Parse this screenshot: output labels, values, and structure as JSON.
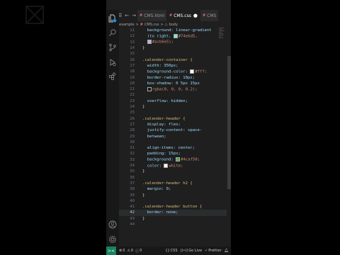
{
  "window": {
    "menu_icon": "menu-icon",
    "tabs": [
      {
        "icon": "css-file-icon",
        "label": "CMS.html",
        "close": "×",
        "active": false
      },
      {
        "icon": "css-file-icon",
        "label": "CMS.css",
        "close": "●",
        "active": true
      },
      {
        "icon": "css-file-icon",
        "label": "CMS",
        "close": "",
        "active": false
      }
    ]
  },
  "breadcrumb": {
    "parts": [
      "example",
      "CMS.css",
      "body"
    ],
    "separator": ">"
  },
  "activity_bar": {
    "icons": [
      "explorer-icon",
      "search-icon",
      "source-control-icon",
      "run-debug-icon",
      "extensions-icon",
      "accounts-icon",
      "settings-gear-icon"
    ],
    "explorer_badge": "1"
  },
  "editor": {
    "current_line": 42,
    "lines": [
      {
        "n": "11",
        "text": "  background: linear-gradient"
      },
      {
        "n": "12",
        "text": "  (to right, ",
        "swatch": "#74ebd5",
        "after": "#74ebd5,"
      },
      {
        "n": "13",
        "text": "  ",
        "swatch": "#acb6e5",
        "after": "#acb6e5);"
      },
      {
        "n": "14",
        "text": "}"
      },
      {
        "n": "15",
        "text": ""
      },
      {
        "n": "16",
        "text": ".calender-container {"
      },
      {
        "n": "17",
        "text": "  width: 350px;"
      },
      {
        "n": "18",
        "text": "  background-color: ",
        "swatch": "#ffffff",
        "after": "#fff;"
      },
      {
        "n": "19",
        "text": "  border-radius: 10px;"
      },
      {
        "n": "20",
        "text": "  box-shadow: 0 5px 15px"
      },
      {
        "n": "21",
        "text": "  ",
        "swatch": "rgba(0,0,0,0.2)",
        "after": "rgba(0, 0, 0, 0.2);"
      },
      {
        "n": "22",
        "text": ""
      },
      {
        "n": "23",
        "text": "  overflow: hidden;"
      },
      {
        "n": "24",
        "text": "}"
      },
      {
        "n": "25",
        "text": ""
      },
      {
        "n": "26",
        "text": ".calender-header {"
      },
      {
        "n": "27",
        "text": "  display: flex;"
      },
      {
        "n": "28",
        "text": "  justify-content: space-"
      },
      {
        "n": "29",
        "text": "  between;"
      },
      {
        "n": "30",
        "text": ""
      },
      {
        "n": "31",
        "text": "  align-items: center;"
      },
      {
        "n": "32",
        "text": "  padding: 15px;"
      },
      {
        "n": "33",
        "text": "  background: ",
        "swatch": "#4caf50",
        "after": "#4caf50;"
      },
      {
        "n": "34",
        "text": "  color: ",
        "swatch": "#ffffff",
        "after": "white;"
      },
      {
        "n": "35",
        "text": "}"
      },
      {
        "n": "36",
        "text": ""
      },
      {
        "n": "37",
        "text": ".calender-header h2 {"
      },
      {
        "n": "38",
        "text": "  margin: 0;"
      },
      {
        "n": "39",
        "text": "}"
      },
      {
        "n": "40",
        "text": ""
      },
      {
        "n": "41",
        "text": ".calender-header button {"
      },
      {
        "n": "42",
        "text": "  border: none;"
      },
      {
        "n": "43",
        "text": "}"
      },
      {
        "n": "44",
        "text": ""
      }
    ]
  },
  "statusbar": {
    "remote_icon": "remote-icon",
    "errors": "0",
    "warnings": "0",
    "info": "0",
    "language": "CSS",
    "go_live": "Go Live",
    "prettier": "Prettier"
  },
  "colors": {
    "editor_bg": "#1f1f1f",
    "activity_bg": "#181818",
    "selector": "#d7ba7d",
    "property": "#9cdcfe",
    "value": "#ce9178",
    "accent": "#0078d4",
    "remote": "#16825d"
  }
}
